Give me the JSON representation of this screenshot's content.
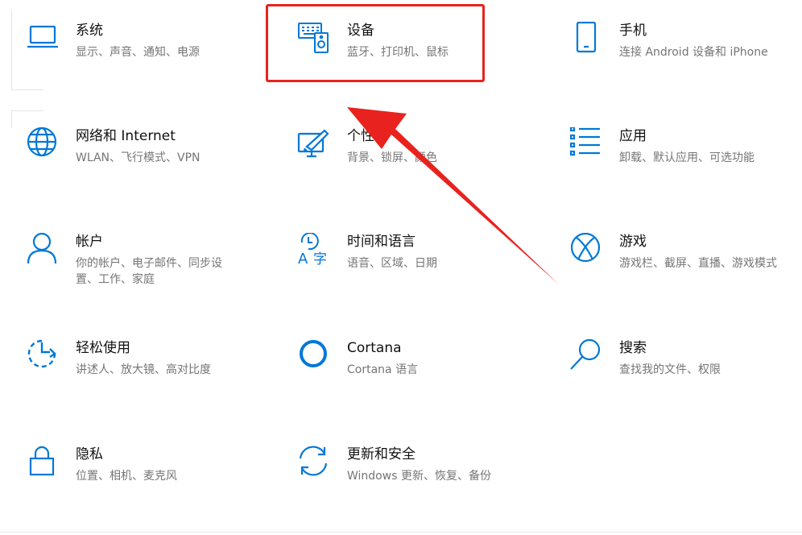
{
  "settings": {
    "tiles": [
      {
        "key": "system",
        "title": "系统",
        "desc": "显示、声音、通知、电源",
        "icon": "laptop-icon"
      },
      {
        "key": "devices",
        "title": "设备",
        "desc": "蓝牙、打印机、鼠标",
        "icon": "keyboard-speaker-icon"
      },
      {
        "key": "phone",
        "title": "手机",
        "desc": "连接 Android 设备和 iPhone",
        "icon": "phone-icon"
      },
      {
        "key": "network",
        "title": "网络和 Internet",
        "desc": "WLAN、飞行模式、VPN",
        "icon": "globe-icon"
      },
      {
        "key": "personalization",
        "title": "个性化",
        "desc": "背景、锁屏、颜色",
        "icon": "paint-brush-icon"
      },
      {
        "key": "apps",
        "title": "应用",
        "desc": "卸载、默认应用、可选功能",
        "icon": "apps-list-icon"
      },
      {
        "key": "accounts",
        "title": "帐户",
        "desc": "你的帐户、电子邮件、同步设置、工作、家庭",
        "icon": "person-icon"
      },
      {
        "key": "time-language",
        "title": "时间和语言",
        "desc": "语音、区域、日期",
        "icon": "time-language-icon"
      },
      {
        "key": "gaming",
        "title": "游戏",
        "desc": "游戏栏、截屏、直播、游戏模式",
        "icon": "xbox-icon"
      },
      {
        "key": "ease-of-access",
        "title": "轻松使用",
        "desc": "讲述人、放大镜、高对比度",
        "icon": "ease-of-access-icon"
      },
      {
        "key": "cortana",
        "title": "Cortana",
        "desc": "Cortana 语言",
        "icon": "cortana-circle-icon"
      },
      {
        "key": "search",
        "title": "搜索",
        "desc": "查找我的文件、权限",
        "icon": "search-icon"
      },
      {
        "key": "privacy",
        "title": "隐私",
        "desc": "位置、相机、麦克风",
        "icon": "lock-icon"
      },
      {
        "key": "update-security",
        "title": "更新和安全",
        "desc": "Windows 更新、恢复、备份",
        "icon": "refresh-icon"
      }
    ]
  },
  "colors": {
    "accent": "#0078d7",
    "annotation": "#e8231f",
    "title_text": "#111111",
    "desc_text": "#757575"
  }
}
